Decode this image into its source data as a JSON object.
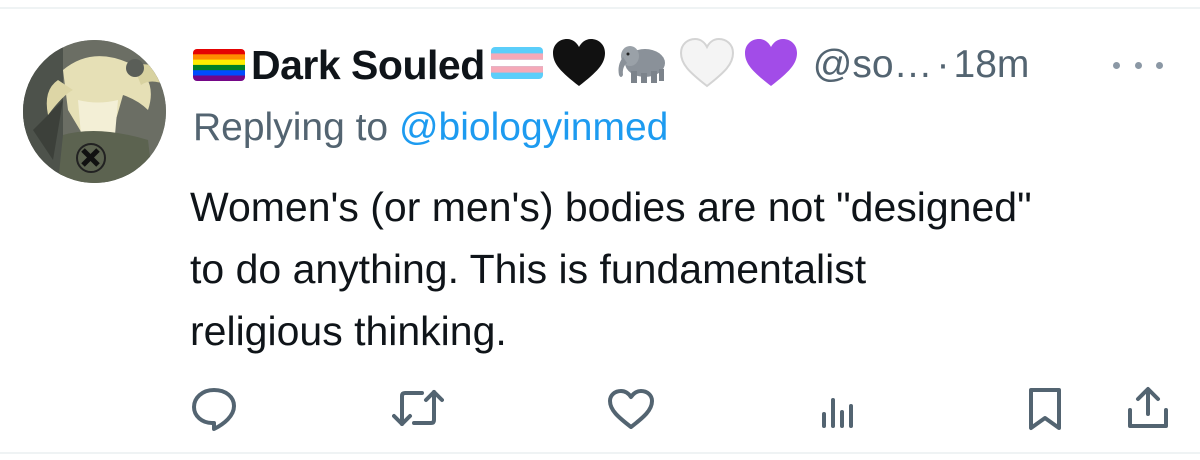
{
  "author": {
    "display_name": "Dark Souled",
    "handle": "@so…",
    "separator": "·",
    "time": "18m",
    "badges": [
      "rainbow-flag",
      "trans-flag",
      "black-heart",
      "elephant",
      "white-heart",
      "purple-heart"
    ]
  },
  "reply": {
    "prefix": "Replying to ",
    "target": "@biologyinmed"
  },
  "body": {
    "lines": [
      "Women's (or men's) bodies are not \"designed\"",
      "to do anything.  This is fundamentalist",
      "religious thinking."
    ]
  },
  "actions": [
    "reply",
    "repost",
    "like",
    "views",
    "bookmark",
    "share"
  ],
  "colors": {
    "primary_text": "#0f1419",
    "secondary_text": "#536471",
    "link": "#1d9bf0",
    "divider": "#eff3f4"
  }
}
